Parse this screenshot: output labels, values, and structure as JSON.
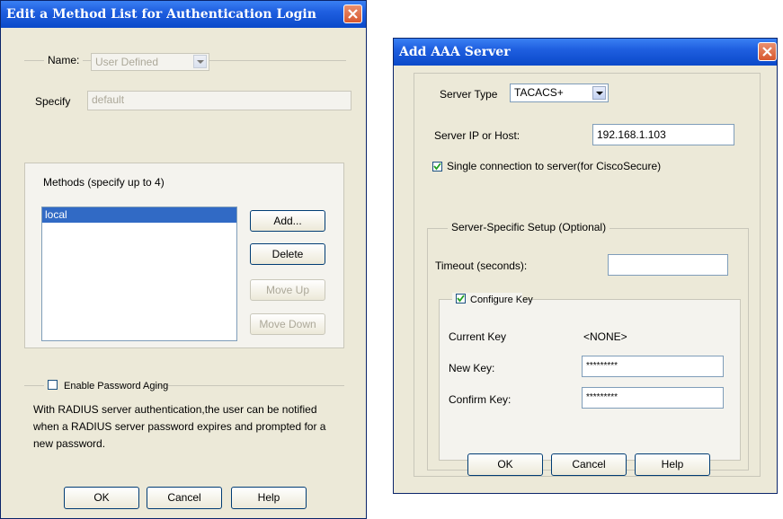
{
  "left_dialog": {
    "title": "Edit a Method List for Authentication Login",
    "name_label": "Name:",
    "name_value": "User Defined",
    "specify_label": "Specify",
    "specify_value": "default",
    "methods_label": "Methods (specify up to 4)",
    "methods": [
      "local"
    ],
    "add_label": "Add...",
    "delete_label": "Delete",
    "move_up_label": "Move Up",
    "move_down_label": "Move Down",
    "enable_password_aging_label": "Enable Password Aging",
    "enable_password_aging_checked": false,
    "info_text": "With RADIUS server authentication,the user can be notified when a RADIUS server password expires and prompted for a new password.",
    "ok_label": "OK",
    "cancel_label": "Cancel",
    "help_label": "Help"
  },
  "right_dialog": {
    "title": "Add AAA Server",
    "server_type_label": "Server Type",
    "server_type_value": "TACACS+",
    "server_ip_label": "Server IP or Host:",
    "server_ip_value": "192.168.1.103",
    "single_connection_label": "Single connection to server(for CiscoSecure)",
    "single_connection_checked": true,
    "server_specific_label": "Server-Specific Setup (Optional)",
    "timeout_label": "Timeout (seconds):",
    "timeout_value": "",
    "configure_key_label": "Configure Key",
    "configure_key_checked": true,
    "current_key_label": "Current Key",
    "current_key_value": "<NONE>",
    "new_key_label": "New Key:",
    "new_key_value": "*********",
    "confirm_key_label": "Confirm Key:",
    "confirm_key_value": "*********",
    "ok_label": "OK",
    "cancel_label": "Cancel",
    "help_label": "Help"
  },
  "colors": {
    "titlebar": "#0a49c9",
    "close_button": "#d8582f",
    "dialog_bg": "#ece9d8",
    "selection": "#316ac5"
  },
  "icons": [
    "close-icon",
    "checkmark-icon",
    "dropdown-arrow-icon"
  ]
}
